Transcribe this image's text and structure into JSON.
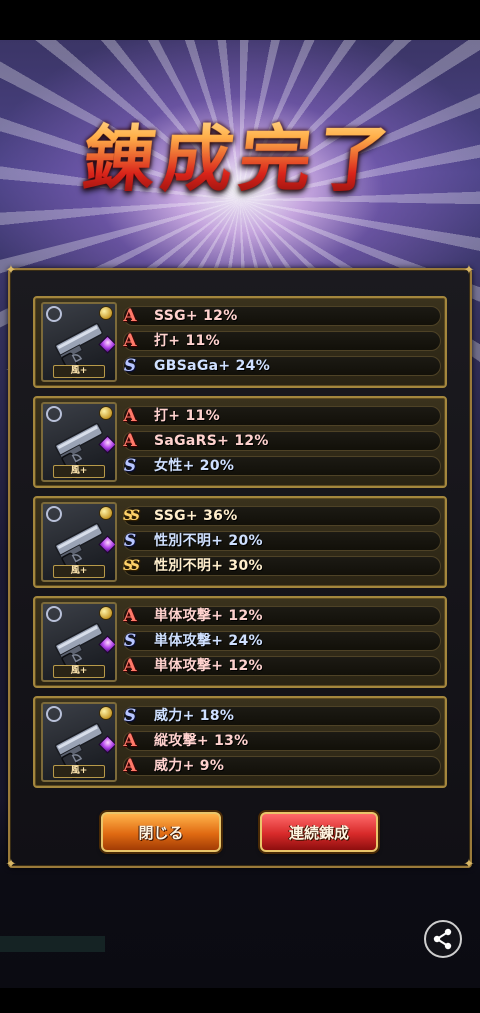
{
  "title": "錬成完了",
  "cards": [
    {
      "element_label": "風+",
      "stats": [
        {
          "rank": "A",
          "rank_class": "a",
          "text": "SSG+ 12%"
        },
        {
          "rank": "A",
          "rank_class": "a",
          "text": "打+ 11%"
        },
        {
          "rank": "S",
          "rank_class": "s",
          "text": "GBSaGa+ 24%"
        }
      ]
    },
    {
      "element_label": "風+",
      "stats": [
        {
          "rank": "A",
          "rank_class": "a",
          "text": "打+ 11%"
        },
        {
          "rank": "A",
          "rank_class": "a",
          "text": "SaGaRS+ 12%"
        },
        {
          "rank": "S",
          "rank_class": "s",
          "text": "女性+ 20%"
        }
      ]
    },
    {
      "element_label": "風+",
      "stats": [
        {
          "rank": "SS",
          "rank_class": "ss",
          "text": "SSG+ 36%"
        },
        {
          "rank": "S",
          "rank_class": "s",
          "text": "性別不明+ 20%"
        },
        {
          "rank": "SS",
          "rank_class": "ss",
          "text": "性別不明+ 30%"
        }
      ]
    },
    {
      "element_label": "風+",
      "stats": [
        {
          "rank": "A",
          "rank_class": "a",
          "text": "単体攻撃+ 12%"
        },
        {
          "rank": "S",
          "rank_class": "s",
          "text": "単体攻撃+ 24%"
        },
        {
          "rank": "A",
          "rank_class": "a",
          "text": "単体攻撃+ 12%"
        }
      ]
    },
    {
      "element_label": "風+",
      "stats": [
        {
          "rank": "S",
          "rank_class": "s",
          "text": "威力+ 18%"
        },
        {
          "rank": "A",
          "rank_class": "a",
          "text": "縦攻撃+ 13%"
        },
        {
          "rank": "A",
          "rank_class": "a",
          "text": "威力+ 9%"
        }
      ]
    }
  ],
  "buttons": {
    "close_label": "閉じる",
    "continue_label": "連続錬成"
  },
  "icons": {
    "share": "share-icon",
    "weapon": "pistol-icon"
  },
  "colors": {
    "rank_a": "#ff7a6a",
    "rank_s": "#b9c6ff",
    "rank_ss": "#ffd36a",
    "frame_gold": "#a4873d"
  }
}
